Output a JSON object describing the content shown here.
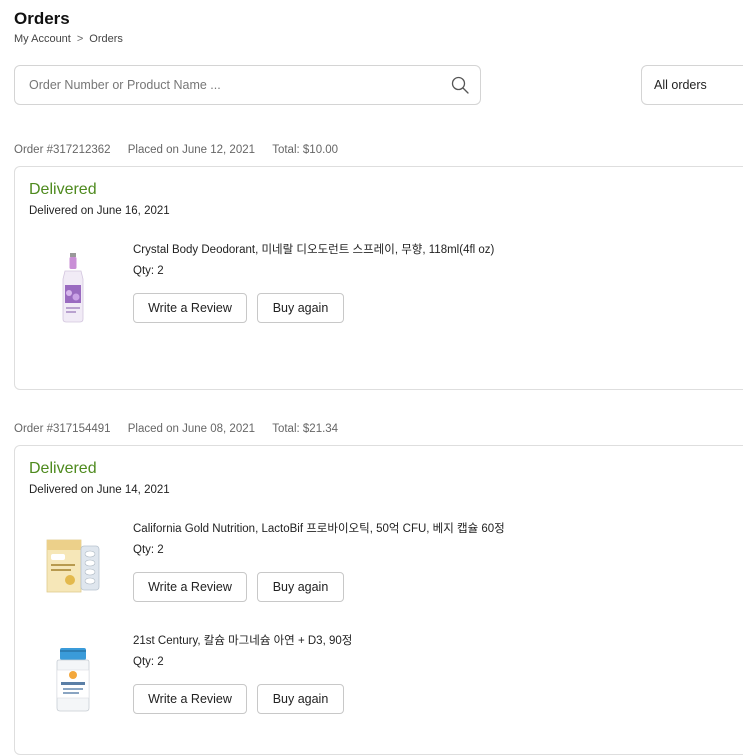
{
  "page": {
    "title": "Orders",
    "breadcrumb": [
      "My Account",
      "Orders"
    ],
    "breadcrumb_separator": ">"
  },
  "search": {
    "placeholder": "Order Number or Product Name ...",
    "value": ""
  },
  "filter": {
    "selected": "All orders"
  },
  "colors": {
    "delivered": "#4e8a1e",
    "border": "#dedede"
  },
  "orders": [
    {
      "number": "Order #317212362",
      "placed": "Placed on June 12, 2021",
      "total": "Total: $10.00",
      "status": "Delivered",
      "status_date": "Delivered on June 16, 2021",
      "items": [
        {
          "name": "Crystal Body Deodorant, 미네랄 디오도런트 스프레이, 무향, 118ml(4fl oz)",
          "qty": "Qty: 2",
          "image": "deodorant-spray-bottle",
          "review_label": "Write a Review",
          "buy_label": "Buy again"
        }
      ]
    },
    {
      "number": "Order #317154491",
      "placed": "Placed on June 08, 2021",
      "total": "Total: $21.34",
      "status": "Delivered",
      "status_date": "Delivered on June 14, 2021",
      "items": [
        {
          "name": "California Gold Nutrition, LactoBif 프로바이오틱, 50억 CFU, 베지 캡슐 60정",
          "qty": "Qty: 2",
          "image": "probiotic-capsule-box",
          "review_label": "Write a Review",
          "buy_label": "Buy again"
        },
        {
          "name": "21st Century, 칼슘 마그네슘 아연 + D3, 90정",
          "qty": "Qty: 2",
          "image": "supplement-bottle",
          "review_label": "Write a Review",
          "buy_label": "Buy again"
        }
      ]
    }
  ]
}
